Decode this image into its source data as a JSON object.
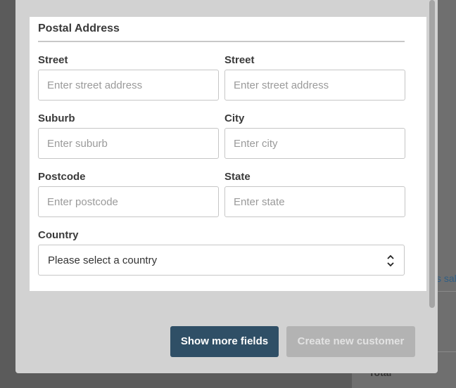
{
  "background": {
    "link_text": "s sal",
    "total_label": "Total"
  },
  "form": {
    "section_title": "Postal Address",
    "fields": [
      {
        "label": "Street",
        "placeholder": "Enter street address"
      },
      {
        "label": "Street",
        "placeholder": "Enter street address"
      },
      {
        "label": "Suburb",
        "placeholder": "Enter suburb"
      },
      {
        "label": "City",
        "placeholder": "Enter city"
      },
      {
        "label": "Postcode",
        "placeholder": "Enter postcode"
      },
      {
        "label": "State",
        "placeholder": "Enter state"
      }
    ],
    "country": {
      "label": "Country",
      "selected": "Please select a country"
    }
  },
  "buttons": {
    "show_more": "Show more fields",
    "create": "Create new customer"
  },
  "colors": {
    "primary_button": "#2f4f66",
    "disabled_button": "#b3b3b3",
    "link": "#2f5f86"
  }
}
